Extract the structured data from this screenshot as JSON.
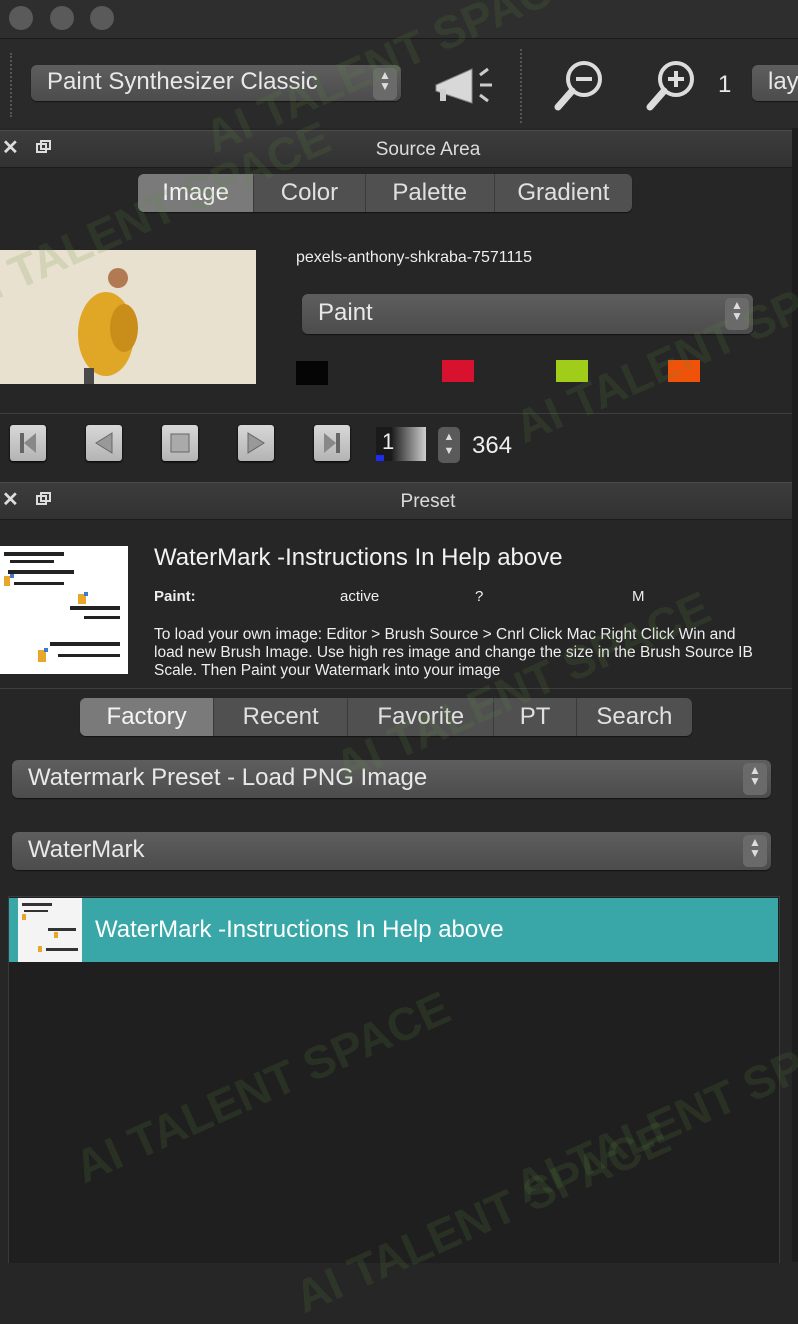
{
  "toolbar": {
    "paint_mode": "Paint Synthesizer Classic",
    "zoom_value": "1",
    "layer_partial": "lay"
  },
  "source_area": {
    "title": "Source Area",
    "tabs": [
      {
        "label": "Image",
        "selected": true
      },
      {
        "label": "Color",
        "selected": false
      },
      {
        "label": "Palette",
        "selected": false
      },
      {
        "label": "Gradient",
        "selected": false
      }
    ],
    "image_name": "pexels-anthony-shkraba-7571115",
    "mode_select": "Paint",
    "swatches": [
      "#050505",
      "#d8112e",
      "#a0cc1a",
      "#f0520a"
    ],
    "frame_input": "1",
    "frame_total": "364"
  },
  "preset": {
    "title": "Preset",
    "name": "WaterMark -Instructions In Help above",
    "paint_label": "Paint:",
    "paint_status": "active",
    "paint_q": "?",
    "paint_m": "M",
    "description": "To load your own image: Editor > Brush Source > Cnrl Click Mac Right Click Win and load new Brush Image.  Use high res image and change the size in the Brush Source IB Scale.  Then Paint your Watermark into your image",
    "tabs": [
      {
        "label": "Factory",
        "selected": true
      },
      {
        "label": "Recent",
        "selected": false
      },
      {
        "label": "Favorite",
        "selected": false
      },
      {
        "label": "PT",
        "selected": false
      },
      {
        "label": "Search",
        "selected": false
      }
    ],
    "category_select": "Watermark Preset - Load PNG Image",
    "subcategory_select": "WaterMark",
    "list": [
      {
        "label": "WaterMark -Instructions In Help above",
        "selected": true
      }
    ]
  },
  "watermark_text": "AI TALENT SPACE"
}
